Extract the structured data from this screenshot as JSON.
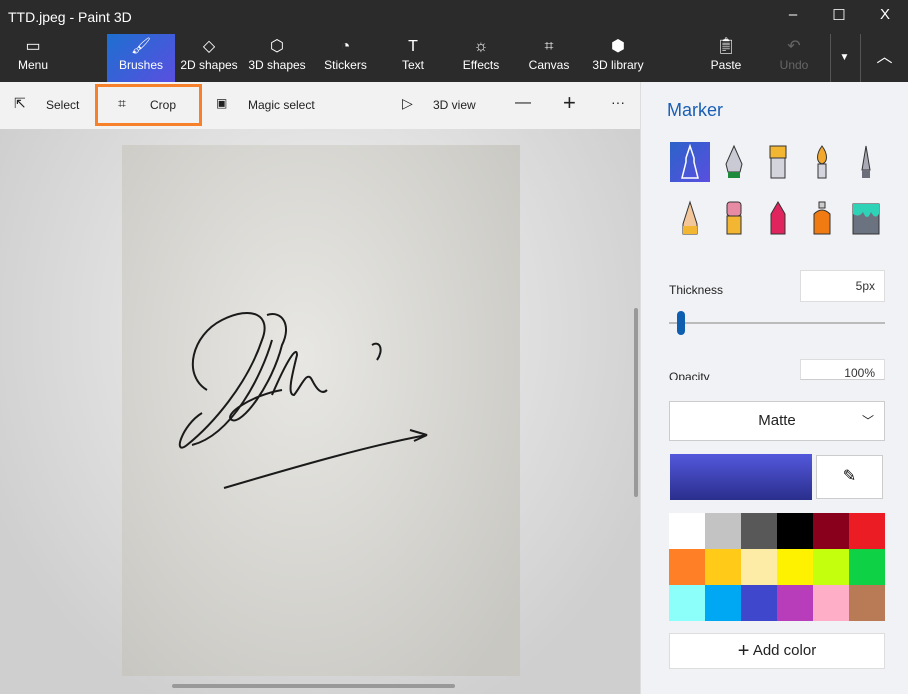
{
  "window": {
    "title": "TTD.jpeg - Paint 3D",
    "minimize": "–",
    "maximize": "☐",
    "close": "X"
  },
  "toolbar": {
    "menu": "Menu",
    "brushes": "Brushes",
    "shapes2d": "2D shapes",
    "shapes3d": "3D shapes",
    "stickers": "Stickers",
    "text": "Text",
    "effects": "Effects",
    "canvas": "Canvas",
    "library": "3D library",
    "paste": "Paste",
    "undo": "Undo"
  },
  "subtoolbar": {
    "select": "Select",
    "crop": "Crop",
    "magic": "Magic select",
    "view3d": "3D view",
    "zoom_out": "—",
    "zoom_in": "+",
    "more": "···"
  },
  "highlight_color": "#f7802a",
  "panel": {
    "title": "Marker",
    "brushes": [
      "marker",
      "calligraphy-pen",
      "oil-brush",
      "watercolor",
      "pen",
      "pencil",
      "eraser",
      "crayon",
      "spray-can",
      "fill"
    ],
    "selected_brush": "marker",
    "thickness_label": "Thickness",
    "thickness_value": "5px",
    "thickness_level": 0.05,
    "opacity_label": "Opacity",
    "opacity_value": "100%",
    "finish": "Matte",
    "current_color": "#3f48cc",
    "add_color": "Add color",
    "palette": [
      "#ffffff",
      "#c3c3c3",
      "#585858",
      "#000000",
      "#88001b",
      "#ec1c24",
      "#ff7f27",
      "#ffca18",
      "#fdeca6",
      "#fff200",
      "#c4ff0e",
      "#0ed145",
      "#8cfffb",
      "#00a8f3",
      "#3f48cc",
      "#b83dba",
      "#ffaec8",
      "#b97a56"
    ]
  }
}
